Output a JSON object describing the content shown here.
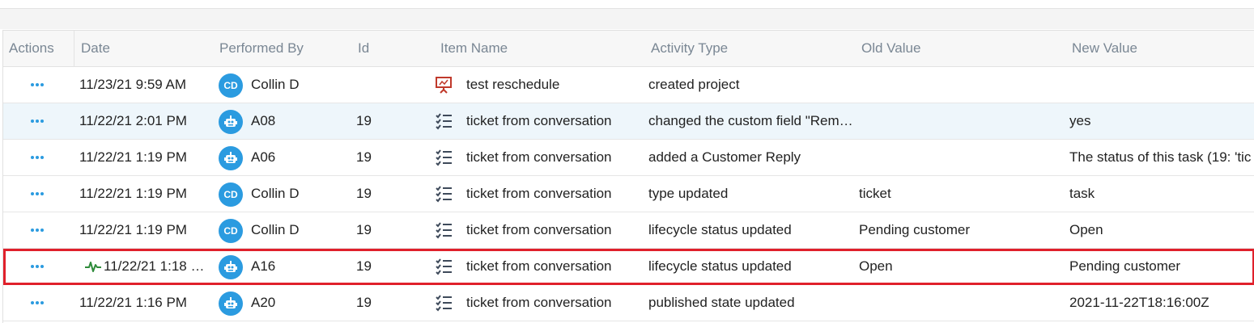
{
  "columns": {
    "actions": "Actions",
    "date": "Date",
    "performed_by": "Performed By",
    "id": "Id",
    "item_name": "Item Name",
    "activity_type": "Activity Type",
    "old_value": "Old Value",
    "new_value": "New Value"
  },
  "colors": {
    "accent": "#2b9be0",
    "selection": "#e0202b",
    "project_icon": "#c0392b"
  },
  "rows": [
    {
      "date": "11/23/21 9:59 AM",
      "avatar_initials": "CD",
      "avatar_type": "user",
      "performer": "Collin D",
      "id": "",
      "item_icon": "presentation-icon",
      "item_name": "test reschedule",
      "activity": "created project",
      "old_value": "",
      "new_value": ""
    },
    {
      "date": "11/22/21 2:01 PM",
      "avatar_initials": "",
      "avatar_type": "bot",
      "performer": "A08",
      "id": "19",
      "item_icon": "checklist-icon",
      "item_name": "ticket from conversation",
      "activity": "changed the custom field \"Rem…",
      "old_value": "",
      "new_value": "yes"
    },
    {
      "date": "11/22/21 1:19 PM",
      "avatar_initials": "",
      "avatar_type": "bot",
      "performer": "A06",
      "id": "19",
      "item_icon": "checklist-icon",
      "item_name": "ticket from conversation",
      "activity": "added a Customer Reply",
      "old_value": "",
      "new_value": "The status of this task (19:  'tic"
    },
    {
      "date": "11/22/21 1:19 PM",
      "avatar_initials": "CD",
      "avatar_type": "user",
      "performer": "Collin D",
      "id": "19",
      "item_icon": "checklist-icon",
      "item_name": "ticket from conversation",
      "activity": "type updated",
      "old_value": "ticket",
      "new_value": "task"
    },
    {
      "date": "11/22/21 1:19 PM",
      "avatar_initials": "CD",
      "avatar_type": "user",
      "performer": "Collin D",
      "id": "19",
      "item_icon": "checklist-icon",
      "item_name": "ticket from conversation",
      "activity": "lifecycle status updated",
      "old_value": "Pending customer",
      "new_value": "Open"
    },
    {
      "date": "11/22/21 1:18 …",
      "avatar_initials": "",
      "avatar_type": "bot",
      "performer": "A16",
      "id": "19",
      "item_icon": "checklist-icon",
      "item_name": "ticket from conversation",
      "activity": "lifecycle status updated",
      "old_value": "Open",
      "new_value": "Pending customer"
    },
    {
      "date": "11/22/21 1:16 PM",
      "avatar_initials": "",
      "avatar_type": "bot",
      "performer": "A20",
      "id": "19",
      "item_icon": "checklist-icon",
      "item_name": "ticket from conversation",
      "activity": "published state updated",
      "old_value": "",
      "new_value": "2021-11-22T18:16:00Z"
    }
  ]
}
